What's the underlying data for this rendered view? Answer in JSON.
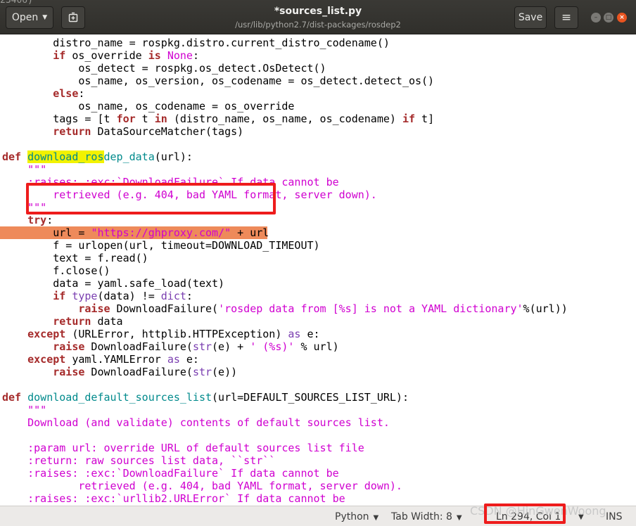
{
  "header": {
    "peek_text": "23406)",
    "open_label": "Open",
    "save_label": "Save",
    "title": "*sources_list.py",
    "subtitle": "/usr/lib/python2.7/dist-packages/rosdep2"
  },
  "icons": {
    "open_dropdown": "chevron-down-icon",
    "new_document": "new-document-icon",
    "menu": "hamburger-menu-icon",
    "minimize": "minimize-icon",
    "maximize": "maximize-icon",
    "close": "close-icon"
  },
  "colors": {
    "keyword": "#a52a2a",
    "string": "#d000d0",
    "function_name": "#008a8c",
    "builtin": "#7a3eb0",
    "search_highlight": "#f2f200",
    "current_line": "#ee8a5a",
    "annotation_box": "#ee1c1c",
    "close_button": "#e95420"
  },
  "code": {
    "lines": [
      [
        {
          "t": "        distro_name = rospkg.distro.current_distro_codename()"
        }
      ],
      [
        {
          "t": "        "
        },
        {
          "t": "if",
          "c": "k"
        },
        {
          "t": " os_override "
        },
        {
          "t": "is",
          "c": "k"
        },
        {
          "t": " "
        },
        {
          "t": "None",
          "c": "s"
        },
        {
          "t": ":"
        }
      ],
      [
        {
          "t": "            os_detect = rospkg.os_detect.OsDetect()"
        }
      ],
      [
        {
          "t": "            os_name, os_version, os_codename = os_detect.detect_os()"
        }
      ],
      [
        {
          "t": "        "
        },
        {
          "t": "else",
          "c": "k"
        },
        {
          "t": ":"
        }
      ],
      [
        {
          "t": "            os_name, os_codename = os_override"
        }
      ],
      [
        {
          "t": "        tags = [t "
        },
        {
          "t": "for",
          "c": "k"
        },
        {
          "t": " t "
        },
        {
          "t": "in",
          "c": "k"
        },
        {
          "t": " (distro_name, os_name, os_codename) "
        },
        {
          "t": "if",
          "c": "k"
        },
        {
          "t": " t]"
        }
      ],
      [
        {
          "t": "        "
        },
        {
          "t": "return",
          "c": "k"
        },
        {
          "t": " DataSourceMatcher(tags)"
        }
      ],
      [],
      [
        {
          "t": "def",
          "c": "k"
        },
        {
          "t": " "
        },
        {
          "t": "download_ros",
          "c": "f hl"
        },
        {
          "t": "dep_data",
          "c": "f"
        },
        {
          "t": "(url):"
        }
      ],
      [
        {
          "t": "    "
        },
        {
          "t": "\"\"\"",
          "c": "s"
        }
      ],
      [
        {
          "t": "    :raises: :exc:`DownloadFailure` If data cannot be",
          "c": "s"
        }
      ],
      [
        {
          "t": "        retrieved (e.g. 404, bad YAML format, server down).",
          "c": "s"
        }
      ],
      [
        {
          "t": "    \"\"\"",
          "c": "s"
        }
      ],
      [
        {
          "t": "    "
        },
        {
          "t": "try",
          "c": "k"
        },
        {
          "t": ":"
        }
      ],
      [
        {
          "t": "        url = "
        },
        {
          "t": "\"https://ghproxy.com/\"",
          "c": "s"
        },
        {
          "t": " + url"
        }
      ],
      [
        {
          "t": "        f = urlopen(url, timeout=DOWNLOAD_TIMEOUT)"
        }
      ],
      [
        {
          "t": "        text = f.read()"
        }
      ],
      [
        {
          "t": "        f.close()"
        }
      ],
      [
        {
          "t": "        data = yaml.safe_load(text)"
        }
      ],
      [
        {
          "t": "        "
        },
        {
          "t": "if",
          "c": "k"
        },
        {
          "t": " "
        },
        {
          "t": "type",
          "c": "b"
        },
        {
          "t": "(data) != "
        },
        {
          "t": "dict",
          "c": "b"
        },
        {
          "t": ":"
        }
      ],
      [
        {
          "t": "            "
        },
        {
          "t": "raise",
          "c": "k"
        },
        {
          "t": " DownloadFailure("
        },
        {
          "t": "'rosdep data from [%s] is not a YAML dictionary'",
          "c": "s"
        },
        {
          "t": "%(url))"
        }
      ],
      [
        {
          "t": "        "
        },
        {
          "t": "return",
          "c": "k"
        },
        {
          "t": " data"
        }
      ],
      [
        {
          "t": "    "
        },
        {
          "t": "except",
          "c": "k"
        },
        {
          "t": " (URLError, httplib.HTTPException) "
        },
        {
          "t": "as",
          "c": "b"
        },
        {
          "t": " e:"
        }
      ],
      [
        {
          "t": "        "
        },
        {
          "t": "raise",
          "c": "k"
        },
        {
          "t": " DownloadFailure("
        },
        {
          "t": "str",
          "c": "b"
        },
        {
          "t": "(e) + "
        },
        {
          "t": "' (%s)'",
          "c": "s"
        },
        {
          "t": " % url)"
        }
      ],
      [
        {
          "t": "    "
        },
        {
          "t": "except",
          "c": "k"
        },
        {
          "t": " yaml.YAMLError "
        },
        {
          "t": "as",
          "c": "b"
        },
        {
          "t": " e:"
        }
      ],
      [
        {
          "t": "        "
        },
        {
          "t": "raise",
          "c": "k"
        },
        {
          "t": " DownloadFailure("
        },
        {
          "t": "str",
          "c": "b"
        },
        {
          "t": "(e))"
        }
      ],
      [],
      [
        {
          "t": "def",
          "c": "k"
        },
        {
          "t": " "
        },
        {
          "t": "download_default_sources_list",
          "c": "f"
        },
        {
          "t": "(url=DEFAULT_SOURCES_LIST_URL):"
        }
      ],
      [
        {
          "t": "    \"\"\"",
          "c": "s"
        }
      ],
      [
        {
          "t": "    Download (and validate) contents of default sources list.",
          "c": "s"
        }
      ],
      [],
      [
        {
          "t": "    :param url: override URL of default sources list file",
          "c": "s"
        }
      ],
      [
        {
          "t": "    :return: raw sources list data, ``str``",
          "c": "s"
        }
      ],
      [
        {
          "t": "    :raises: :exc:`DownloadFailure` If data cannot be",
          "c": "s"
        }
      ],
      [
        {
          "t": "            retrieved (e.g. 404, bad YAML format, server down).",
          "c": "s"
        }
      ],
      [
        {
          "t": "    :raises: :exc:`urllib2.URLError` If data cannot be",
          "c": "s"
        }
      ]
    ]
  },
  "statusbar": {
    "language": "Python",
    "tab_width": "Tab Width: 8",
    "position": "Ln 294, Col 1",
    "mode": "INS",
    "watermark": "CSDN @HinGwenWoong"
  }
}
